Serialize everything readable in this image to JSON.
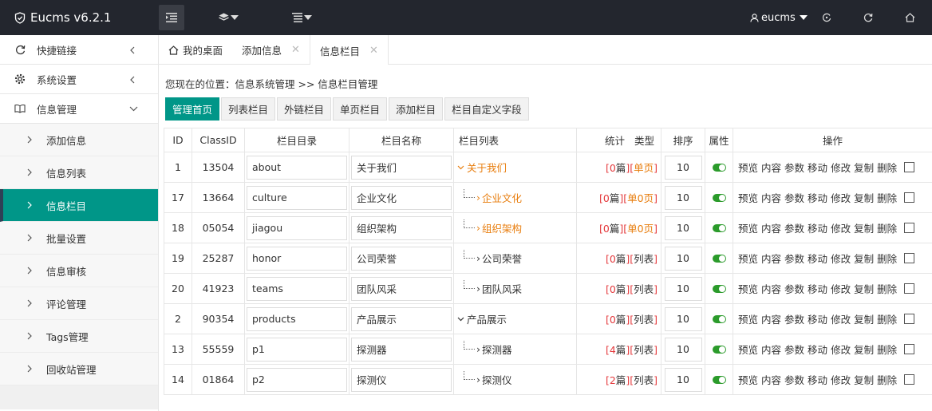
{
  "app": {
    "title": "Eucms v6.2.1",
    "user": "eucms"
  },
  "sidebar": {
    "groups": [
      {
        "label": "快捷链接"
      },
      {
        "label": "系统设置"
      },
      {
        "label": "信息管理"
      }
    ],
    "items": [
      {
        "label": "添加信息"
      },
      {
        "label": "信息列表"
      },
      {
        "label": "信息栏目"
      },
      {
        "label": "批量设置"
      },
      {
        "label": "信息审核"
      },
      {
        "label": "评论管理"
      },
      {
        "label": "Tags管理"
      },
      {
        "label": "回收站管理"
      }
    ]
  },
  "tabs": [
    {
      "label": "我的桌面"
    },
    {
      "label": "添加信息"
    },
    {
      "label": "信息栏目"
    }
  ],
  "main": {
    "breadcrumb": "您现在的位置：信息系统管理 >> 信息栏目管理",
    "buttons": [
      "管理首页",
      "列表栏目",
      "外链栏目",
      "单页栏目",
      "添加栏目",
      "栏目自定义字段"
    ],
    "columns": {
      "id": "ID",
      "classid": "ClassID",
      "dir": "栏目目录",
      "name": "栏目名称",
      "list": "栏目列表",
      "stat": "统计",
      "type": "类型",
      "sort": "排序",
      "attr": "属性",
      "ops": "操作"
    },
    "op_labels": [
      "预览",
      "内容",
      "参数",
      "移动",
      "修改",
      "复制",
      "删除"
    ],
    "rows": [
      {
        "id": "1",
        "classid": "13504",
        "dir": "about",
        "name": "关于我们",
        "tree": "关于我们",
        "count": "0",
        "type": "单页"
      },
      {
        "id": "17",
        "classid": "13664",
        "dir": "culture",
        "name": "企业文化",
        "tree": "企业文化",
        "count": "0",
        "type": "单0页"
      },
      {
        "id": "18",
        "classid": "05054",
        "dir": "jiagou",
        "name": "组织架构",
        "tree": "组织架构",
        "count": "0",
        "type": "单0页"
      },
      {
        "id": "19",
        "classid": "25287",
        "dir": "honor",
        "name": "公司荣誉",
        "tree": "公司荣誉",
        "count": "0",
        "type": "列表"
      },
      {
        "id": "20",
        "classid": "41923",
        "dir": "teams",
        "name": "团队风采",
        "tree": "团队风采",
        "count": "0",
        "type": "列表"
      },
      {
        "id": "2",
        "classid": "90354",
        "dir": "products",
        "name": "产品展示",
        "tree": "产品展示",
        "count": "0",
        "type": "列表"
      },
      {
        "id": "13",
        "classid": "55559",
        "dir": "p1",
        "name": "探测器",
        "tree": "探测器",
        "count": "4",
        "type": "列表"
      },
      {
        "id": "14",
        "classid": "01864",
        "dir": "p2",
        "name": "探测仪",
        "tree": "探测仪",
        "count": "2",
        "type": "列表"
      }
    ],
    "sort_value": "10",
    "pian": "篇"
  }
}
